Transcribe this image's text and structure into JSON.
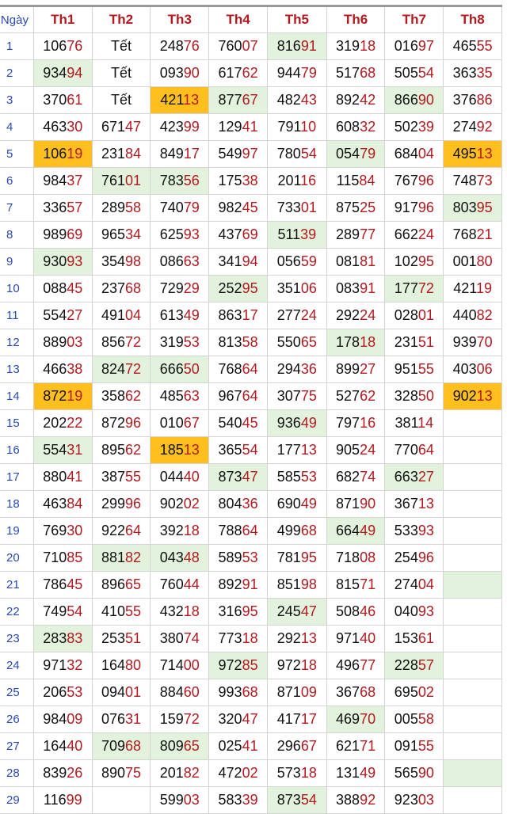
{
  "header": {
    "day": "Ngày",
    "months": [
      "Th1",
      "Th2",
      "Th3",
      "Th4",
      "Th5",
      "Th6",
      "Th7",
      "Th8"
    ]
  },
  "rows": [
    {
      "day": "1",
      "cells": [
        {
          "v": "10676"
        },
        {
          "v": "Tết"
        },
        {
          "v": "24876"
        },
        {
          "v": "76007"
        },
        {
          "v": "81691",
          "hl": "green"
        },
        {
          "v": "31918"
        },
        {
          "v": "01697"
        },
        {
          "v": "46555"
        }
      ]
    },
    {
      "day": "2",
      "cells": [
        {
          "v": "93494",
          "hl": "green"
        },
        {
          "v": "Tết"
        },
        {
          "v": "09390"
        },
        {
          "v": "61762"
        },
        {
          "v": "94479"
        },
        {
          "v": "51768"
        },
        {
          "v": "50554"
        },
        {
          "v": "36335"
        }
      ]
    },
    {
      "day": "3",
      "cells": [
        {
          "v": "37061"
        },
        {
          "v": "Tết"
        },
        {
          "v": "42113",
          "hl": "yellow"
        },
        {
          "v": "87767",
          "hl": "green"
        },
        {
          "v": "48243"
        },
        {
          "v": "89242"
        },
        {
          "v": "86690",
          "hl": "green"
        },
        {
          "v": "37686"
        }
      ]
    },
    {
      "day": "4",
      "cells": [
        {
          "v": "46330"
        },
        {
          "v": "67147"
        },
        {
          "v": "42399"
        },
        {
          "v": "12941"
        },
        {
          "v": "79110"
        },
        {
          "v": "60832"
        },
        {
          "v": "50239"
        },
        {
          "v": "27492"
        }
      ]
    },
    {
      "day": "5",
      "cells": [
        {
          "v": "10619",
          "hl": "yellow"
        },
        {
          "v": "23184"
        },
        {
          "v": "84917"
        },
        {
          "v": "54997"
        },
        {
          "v": "78054"
        },
        {
          "v": "05479",
          "hl": "green"
        },
        {
          "v": "68404"
        },
        {
          "v": "49513",
          "hl": "yellow"
        }
      ]
    },
    {
      "day": "6",
      "cells": [
        {
          "v": "98437"
        },
        {
          "v": "76101",
          "hl": "green"
        },
        {
          "v": "78356",
          "hl": "green"
        },
        {
          "v": "17538"
        },
        {
          "v": "20116"
        },
        {
          "v": "11584"
        },
        {
          "v": "76796"
        },
        {
          "v": "74873"
        }
      ]
    },
    {
      "day": "7",
      "cells": [
        {
          "v": "33657"
        },
        {
          "v": "28958"
        },
        {
          "v": "74079"
        },
        {
          "v": "98245"
        },
        {
          "v": "73301"
        },
        {
          "v": "87525"
        },
        {
          "v": "91796"
        },
        {
          "v": "80395",
          "hl": "green"
        }
      ]
    },
    {
      "day": "8",
      "cells": [
        {
          "v": "98969"
        },
        {
          "v": "96534"
        },
        {
          "v": "62593"
        },
        {
          "v": "43769"
        },
        {
          "v": "51139",
          "hl": "green"
        },
        {
          "v": "28977"
        },
        {
          "v": "66224"
        },
        {
          "v": "76821"
        }
      ]
    },
    {
      "day": "9",
      "cells": [
        {
          "v": "93093",
          "hl": "green"
        },
        {
          "v": "35498"
        },
        {
          "v": "08663"
        },
        {
          "v": "34194"
        },
        {
          "v": "05659"
        },
        {
          "v": "08181"
        },
        {
          "v": "10295"
        },
        {
          "v": "00180"
        }
      ]
    },
    {
      "day": "10",
      "cells": [
        {
          "v": "08845"
        },
        {
          "v": "23768"
        },
        {
          "v": "72929"
        },
        {
          "v": "25295",
          "hl": "green"
        },
        {
          "v": "35106"
        },
        {
          "v": "08391"
        },
        {
          "v": "17772",
          "hl": "green"
        },
        {
          "v": "42119"
        }
      ]
    },
    {
      "day": "11",
      "cells": [
        {
          "v": "55427"
        },
        {
          "v": "49104"
        },
        {
          "v": "61349"
        },
        {
          "v": "86317"
        },
        {
          "v": "27724"
        },
        {
          "v": "29224"
        },
        {
          "v": "02801"
        },
        {
          "v": "44082"
        }
      ]
    },
    {
      "day": "12",
      "cells": [
        {
          "v": "88903"
        },
        {
          "v": "85672"
        },
        {
          "v": "31953"
        },
        {
          "v": "81358"
        },
        {
          "v": "55065"
        },
        {
          "v": "17818",
          "hl": "green"
        },
        {
          "v": "23151"
        },
        {
          "v": "93970"
        }
      ]
    },
    {
      "day": "13",
      "cells": [
        {
          "v": "46638"
        },
        {
          "v": "82472",
          "hl": "green"
        },
        {
          "v": "66650",
          "hl": "green"
        },
        {
          "v": "76864"
        },
        {
          "v": "29436"
        },
        {
          "v": "89927"
        },
        {
          "v": "95155"
        },
        {
          "v": "40306"
        }
      ]
    },
    {
      "day": "14",
      "cells": [
        {
          "v": "87219",
          "hl": "yellow"
        },
        {
          "v": "35862"
        },
        {
          "v": "48563"
        },
        {
          "v": "96764"
        },
        {
          "v": "30775"
        },
        {
          "v": "52762"
        },
        {
          "v": "32850"
        },
        {
          "v": "90213",
          "hl": "yellow"
        }
      ]
    },
    {
      "day": "15",
      "cells": [
        {
          "v": "20222"
        },
        {
          "v": "87296"
        },
        {
          "v": "01067"
        },
        {
          "v": "54045"
        },
        {
          "v": "93649",
          "hl": "green"
        },
        {
          "v": "79716"
        },
        {
          "v": "38114"
        },
        {
          "v": ""
        }
      ]
    },
    {
      "day": "16",
      "cells": [
        {
          "v": "55431",
          "hl": "green"
        },
        {
          "v": "89562"
        },
        {
          "v": "18513",
          "hl": "yellow"
        },
        {
          "v": "36554"
        },
        {
          "v": "17713"
        },
        {
          "v": "90524"
        },
        {
          "v": "77064"
        },
        {
          "v": ""
        }
      ]
    },
    {
      "day": "17",
      "cells": [
        {
          "v": "88041"
        },
        {
          "v": "38755"
        },
        {
          "v": "04440"
        },
        {
          "v": "87347",
          "hl": "green"
        },
        {
          "v": "58553"
        },
        {
          "v": "68274"
        },
        {
          "v": "66327",
          "hl": "green"
        },
        {
          "v": ""
        }
      ]
    },
    {
      "day": "18",
      "cells": [
        {
          "v": "46384"
        },
        {
          "v": "29996"
        },
        {
          "v": "90202"
        },
        {
          "v": "80436"
        },
        {
          "v": "69049"
        },
        {
          "v": "87190"
        },
        {
          "v": "36713"
        },
        {
          "v": ""
        }
      ]
    },
    {
      "day": "19",
      "cells": [
        {
          "v": "76930"
        },
        {
          "v": "92264"
        },
        {
          "v": "39218"
        },
        {
          "v": "78864"
        },
        {
          "v": "49968"
        },
        {
          "v": "66449",
          "hl": "green"
        },
        {
          "v": "53393"
        },
        {
          "v": ""
        }
      ]
    },
    {
      "day": "20",
      "cells": [
        {
          "v": "71085"
        },
        {
          "v": "88182",
          "hl": "green"
        },
        {
          "v": "04348",
          "hl": "green"
        },
        {
          "v": "58953"
        },
        {
          "v": "78195"
        },
        {
          "v": "71808"
        },
        {
          "v": "25496"
        },
        {
          "v": ""
        }
      ]
    },
    {
      "day": "21",
      "cells": [
        {
          "v": "78645"
        },
        {
          "v": "89665"
        },
        {
          "v": "76044"
        },
        {
          "v": "89291"
        },
        {
          "v": "85198"
        },
        {
          "v": "81571"
        },
        {
          "v": "27404"
        },
        {
          "v": "",
          "hl": "green"
        }
      ]
    },
    {
      "day": "22",
      "cells": [
        {
          "v": "74954"
        },
        {
          "v": "41055"
        },
        {
          "v": "43218"
        },
        {
          "v": "31695"
        },
        {
          "v": "24547",
          "hl": "green"
        },
        {
          "v": "50846"
        },
        {
          "v": "04093"
        },
        {
          "v": ""
        }
      ]
    },
    {
      "day": "23",
      "cells": [
        {
          "v": "28383",
          "hl": "green"
        },
        {
          "v": "25351"
        },
        {
          "v": "38074"
        },
        {
          "v": "77318"
        },
        {
          "v": "29213"
        },
        {
          "v": "97140"
        },
        {
          "v": "15361"
        },
        {
          "v": ""
        }
      ]
    },
    {
      "day": "24",
      "cells": [
        {
          "v": "97132"
        },
        {
          "v": "16480"
        },
        {
          "v": "71400"
        },
        {
          "v": "97285",
          "hl": "green"
        },
        {
          "v": "97218"
        },
        {
          "v": "49677"
        },
        {
          "v": "22857",
          "hl": "green"
        },
        {
          "v": ""
        }
      ]
    },
    {
      "day": "25",
      "cells": [
        {
          "v": "20653"
        },
        {
          "v": "09401"
        },
        {
          "v": "88460"
        },
        {
          "v": "99368"
        },
        {
          "v": "87109"
        },
        {
          "v": "36768"
        },
        {
          "v": "69502"
        },
        {
          "v": ""
        }
      ]
    },
    {
      "day": "26",
      "cells": [
        {
          "v": "98409"
        },
        {
          "v": "07631"
        },
        {
          "v": "15972"
        },
        {
          "v": "32047"
        },
        {
          "v": "41717"
        },
        {
          "v": "46970",
          "hl": "green"
        },
        {
          "v": "00558"
        },
        {
          "v": ""
        }
      ]
    },
    {
      "day": "27",
      "cells": [
        {
          "v": "16440"
        },
        {
          "v": "70968",
          "hl": "green"
        },
        {
          "v": "80965",
          "hl": "green"
        },
        {
          "v": "02541"
        },
        {
          "v": "29667"
        },
        {
          "v": "62171"
        },
        {
          "v": "09155"
        },
        {
          "v": ""
        }
      ]
    },
    {
      "day": "28",
      "cells": [
        {
          "v": "83926"
        },
        {
          "v": "89075"
        },
        {
          "v": "20182"
        },
        {
          "v": "47202"
        },
        {
          "v": "57318"
        },
        {
          "v": "13149"
        },
        {
          "v": "56590"
        },
        {
          "v": "",
          "hl": "green"
        }
      ]
    },
    {
      "day": "29",
      "cells": [
        {
          "v": "11699"
        },
        {
          "v": ""
        },
        {
          "v": "59903"
        },
        {
          "v": "58339"
        },
        {
          "v": "87354",
          "hl": "green"
        },
        {
          "v": "38892"
        },
        {
          "v": "92303"
        },
        {
          "v": ""
        }
      ]
    }
  ],
  "colors": {
    "header_text": "#b3191e",
    "day_text": "#2a49b8",
    "suffix_text": "#b3191e",
    "green_highlight": "#e2f2dc",
    "yellow_highlight": "#ffc01f"
  }
}
